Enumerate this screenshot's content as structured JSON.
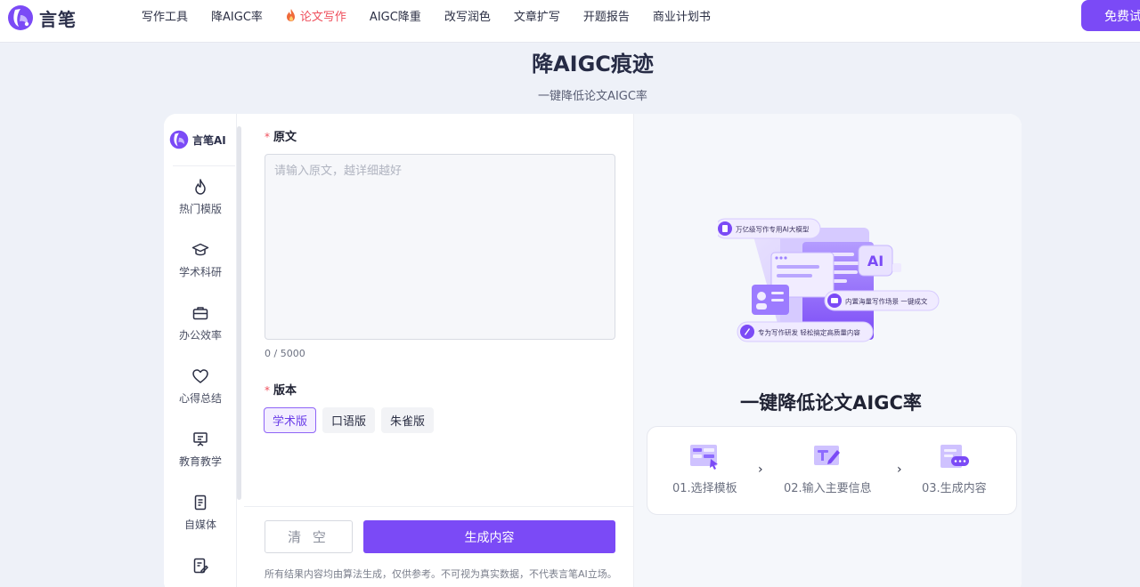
{
  "nav": {
    "brand": "言笔",
    "items": [
      {
        "label": "写作工具",
        "active": false
      },
      {
        "label": "降AIGC率",
        "active": false
      },
      {
        "label": "论文写作",
        "active": true,
        "icon": "fire-icon"
      },
      {
        "label": "AIGC降重",
        "active": false
      },
      {
        "label": "改写润色",
        "active": false
      },
      {
        "label": "文章扩写",
        "active": false
      },
      {
        "label": "开题报告",
        "active": false
      },
      {
        "label": "商业计划书",
        "active": false
      }
    ],
    "cta": "免费试用"
  },
  "header": {
    "title": "降AIGC痕迹",
    "subtitle": "一键降低论文AIGC率"
  },
  "sidebar": {
    "brand": "言笔AI",
    "items": [
      {
        "label": "热门模版",
        "icon": "fire-icon"
      },
      {
        "label": "学术科研",
        "icon": "graduation-cap-icon"
      },
      {
        "label": "办公效率",
        "icon": "briefcase-icon"
      },
      {
        "label": "心得总结",
        "icon": "heart-icon"
      },
      {
        "label": "教育教学",
        "icon": "presentation-board-icon"
      },
      {
        "label": "自媒体",
        "icon": "document-icon"
      },
      {
        "label": "",
        "icon": "edit-document-icon"
      }
    ]
  },
  "form": {
    "source_label": "原文",
    "source_placeholder": "请输入原文，越详细越好",
    "source_value": "",
    "counter": "0 / 5000",
    "version_label": "版本",
    "versions": [
      {
        "label": "学术版",
        "selected": true
      },
      {
        "label": "口语版",
        "selected": false
      },
      {
        "label": "朱雀版",
        "selected": false
      }
    ],
    "clear_label": "清 空",
    "generate_label": "生成内容",
    "disclaimer": "所有结果内容均由算法生成，仅供参考。不可视为真实数据，不代表言笔AI立场。"
  },
  "preview": {
    "badges": [
      "万亿级写作专用AI大模型",
      "内置海量写作场景 一键成文",
      "专为写作研发 轻松搞定高质量内容"
    ],
    "badge_ai": "AI",
    "title": "一键降低论文AIGC率",
    "steps": [
      {
        "label": "01.选择模板",
        "icon": "select-template-icon"
      },
      {
        "label": "02.输入主要信息",
        "icon": "input-info-icon"
      },
      {
        "label": "03.生成内容",
        "icon": "generate-content-icon"
      }
    ],
    "step_arrow": "›"
  },
  "colors": {
    "accent": "#7b4af6",
    "active_nav": "#ef4f5c",
    "background": "#eef1f8"
  }
}
